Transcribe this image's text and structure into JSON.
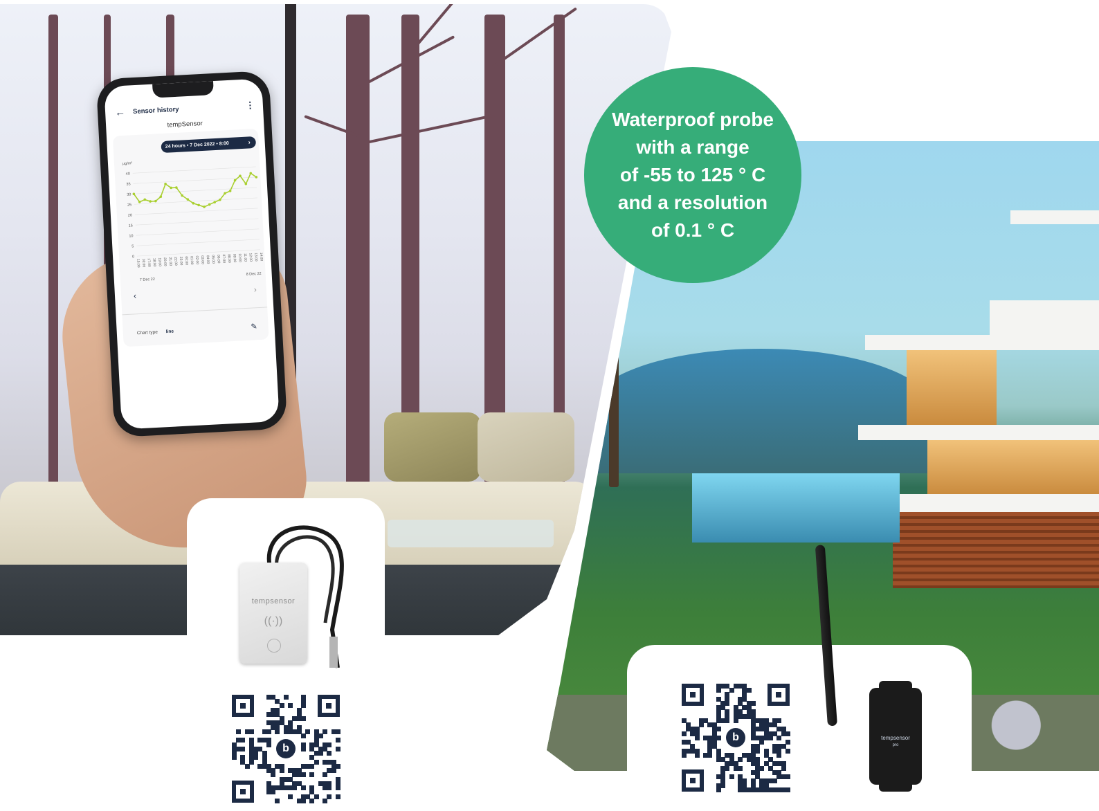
{
  "left_scene": {
    "phone": {
      "app_title": "Sensor history",
      "back_icon": "arrow-left-icon",
      "menu_icon": "more-vertical-icon",
      "sensor_name": "tempSensor",
      "range_label": "24 hours • 7 Dec 2022 • 8:00",
      "range_chevron": "›",
      "unit_label": "µg/m³",
      "date_start": "7 Dec 22",
      "date_end": "8 Dec 22",
      "prev_glyph": "‹",
      "next_glyph": "›",
      "chart_type_label": "Chart type",
      "chart_type_value": "line",
      "edit_icon": "pencil-icon",
      "line_color": "#a9cf2f"
    },
    "device_brand": "tempsensor"
  },
  "badge": {
    "lines": [
      "Waterproof probe",
      "with a range",
      "of -55 to 125 ° C",
      "and a resolution",
      "of 0.1 ° C"
    ],
    "color": "#36ad79"
  },
  "right_scene": {
    "device_brand": "tempsensor",
    "device_sub": "pro"
  },
  "chart_data": {
    "type": "line",
    "x": [
      "15:00",
      "16:00",
      "17:00",
      "18:00",
      "19:00",
      "20:00",
      "21:00",
      "22:00",
      "23:00",
      "00:00",
      "01:00",
      "02:00",
      "03:00",
      "04:00",
      "05:00",
      "06:00",
      "07:00",
      "08:00",
      "09:00",
      "10:00",
      "11:00",
      "12:00",
      "13:00",
      "14:00"
    ],
    "series": [
      {
        "values": [
          30,
          26,
          27,
          26,
          26,
          28,
          34,
          32,
          32,
          28,
          26,
          24,
          23,
          22,
          23,
          24,
          25,
          28,
          29,
          34,
          36,
          32,
          37,
          35
        ]
      }
    ],
    "ylabel": "µg/m³",
    "yticks": [
      0,
      5,
      10,
      15,
      20,
      25,
      30,
      35,
      40
    ],
    "ylim": [
      0,
      40
    ],
    "grid": true
  }
}
